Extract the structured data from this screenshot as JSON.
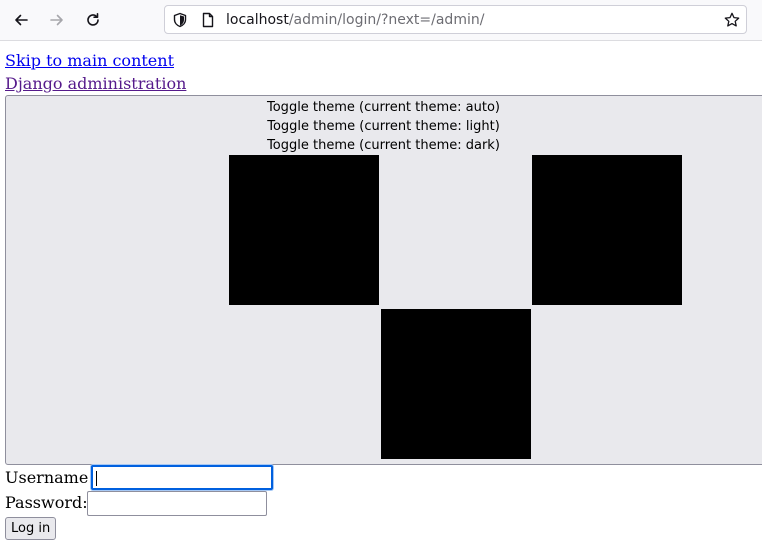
{
  "browser": {
    "url_host": "localhost",
    "url_path": "/admin/login/?next=/admin/",
    "icons": {
      "back": "back-arrow-icon",
      "forward": "forward-arrow-icon",
      "reload": "reload-icon",
      "tracking": "shield-icon",
      "page_info": "page-icon",
      "bookmark": "star-icon"
    }
  },
  "page": {
    "skip_link": "Skip to main content",
    "site_link": "Django administration",
    "theme_toggle": {
      "auto": "Toggle theme (current theme: auto)",
      "light": "Toggle theme (current theme: light)",
      "dark": "Toggle theme (current theme: dark)"
    },
    "login_form": {
      "username_label": "Username:",
      "username_value": "",
      "password_label": "Password:",
      "password_value": "",
      "submit_label": "Log in"
    }
  },
  "colors": {
    "link": "#0000ee",
    "visited_link": "#551a8b",
    "focus_ring": "#0060df",
    "button_bg": "#e9e9ed"
  }
}
